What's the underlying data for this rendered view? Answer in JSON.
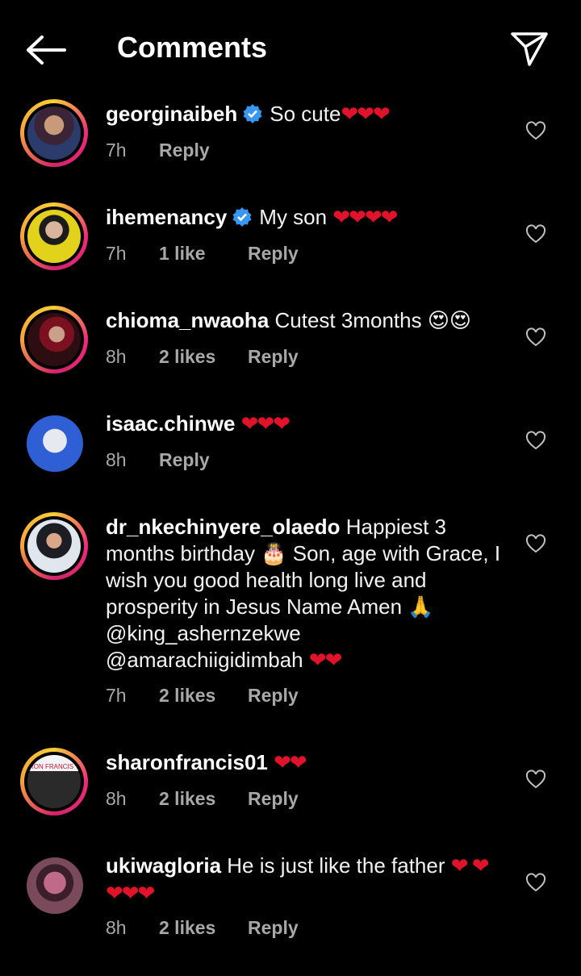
{
  "header": {
    "title": "Comments",
    "back_icon": "arrow-left-icon",
    "share_icon": "paper-plane-icon"
  },
  "accent": {
    "verified": "#3897f0",
    "heart": "#e0132a",
    "meta": "#a8a8a8"
  },
  "comments": [
    {
      "username": "georginaibeh",
      "verified": true,
      "text": "So cute",
      "emoji": "❤❤❤",
      "time": "7h",
      "likes": "",
      "reply": "Reply"
    },
    {
      "username": "ihemenancy",
      "verified": true,
      "text": "My son ",
      "emoji": "❤❤❤❤",
      "time": "7h",
      "likes": "1 like",
      "reply": "Reply"
    },
    {
      "username": "chioma_nwaoha",
      "verified": false,
      "text": "Cutest 3months ",
      "emoji": "😍😍",
      "time": "8h",
      "likes": "2 likes",
      "reply": "Reply"
    },
    {
      "username": "isaac.chinwe",
      "verified": false,
      "text": "",
      "emoji": "❤❤❤",
      "time": "8h",
      "likes": "",
      "reply": "Reply"
    },
    {
      "username": "dr_nkechinyere_olaedo",
      "verified": false,
      "text": "Happiest 3 months birthday 🎂 Son, age with Grace, I wish you good health long live and prosperity in Jesus Name Amen 🙏  @king_ashernzekwe @amarachiigidimbah ",
      "emoji": "❤❤",
      "time": "7h",
      "likes": "2 likes",
      "reply": "Reply"
    },
    {
      "username": "sharonfrancis01",
      "verified": false,
      "text": "",
      "emoji": "❤❤",
      "time": "8h",
      "likes": "2 likes",
      "reply": "Reply",
      "avatar_text": "RON FRANCIS T"
    },
    {
      "username": "ukiwagloria",
      "verified": false,
      "text": "He is just like the father ",
      "emoji": "❤ ❤❤❤❤",
      "time": "8h",
      "likes": "2 likes",
      "reply": "Reply"
    }
  ]
}
